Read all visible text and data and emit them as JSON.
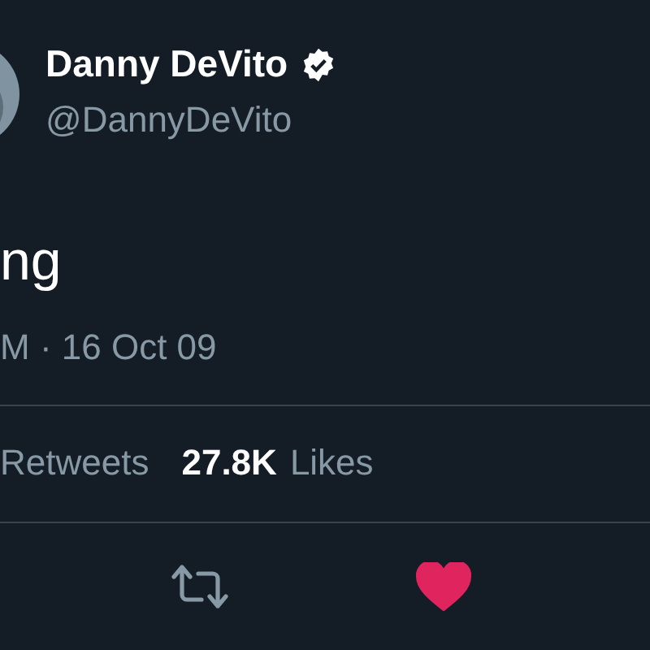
{
  "author": {
    "name": "Danny DeVito",
    "verified": true,
    "handle": "@DannyDeVito"
  },
  "tweet": {
    "text": "ng",
    "timestamp": "M · 16 Oct 09"
  },
  "stats": [
    {
      "label": "Retweets"
    },
    {
      "count": "27.8K",
      "label": "Likes"
    }
  ],
  "actions": [
    {
      "kind": "retweet",
      "selected": false
    },
    {
      "kind": "like",
      "selected": true
    }
  ]
}
